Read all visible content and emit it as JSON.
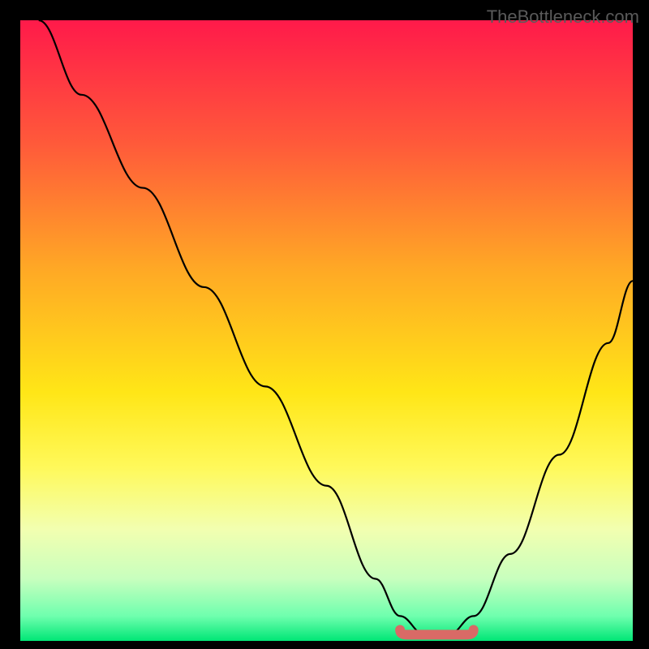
{
  "watermark": "TheBottleneck.com",
  "chart_data": {
    "type": "line",
    "title": "",
    "xlabel": "",
    "ylabel": "",
    "xlim": [
      0,
      100
    ],
    "ylim": [
      0,
      100
    ],
    "grid": false,
    "legend": false,
    "series": [
      {
        "name": "curve",
        "x": [
          3,
          10,
          20,
          30,
          40,
          50,
          58,
          62,
          66,
          70,
          74,
          80,
          88,
          96,
          100
        ],
        "y": [
          100,
          88,
          73,
          57,
          41,
          25,
          10,
          4,
          1,
          1,
          4,
          14,
          30,
          48,
          58
        ]
      }
    ],
    "highlight": {
      "name": "valley-marker",
      "x_start": 62,
      "x_end": 74,
      "y": 1,
      "color": "#d96a66"
    },
    "gradient_stops": [
      {
        "offset": 0.0,
        "color": "#ff1a4a"
      },
      {
        "offset": 0.2,
        "color": "#ff5a3a"
      },
      {
        "offset": 0.4,
        "color": "#ffa825"
      },
      {
        "offset": 0.6,
        "color": "#ffe617"
      },
      {
        "offset": 0.72,
        "color": "#fff95a"
      },
      {
        "offset": 0.82,
        "color": "#f2ffb0"
      },
      {
        "offset": 0.9,
        "color": "#c8ffbe"
      },
      {
        "offset": 0.96,
        "color": "#6fffae"
      },
      {
        "offset": 1.0,
        "color": "#00e676"
      }
    ]
  }
}
